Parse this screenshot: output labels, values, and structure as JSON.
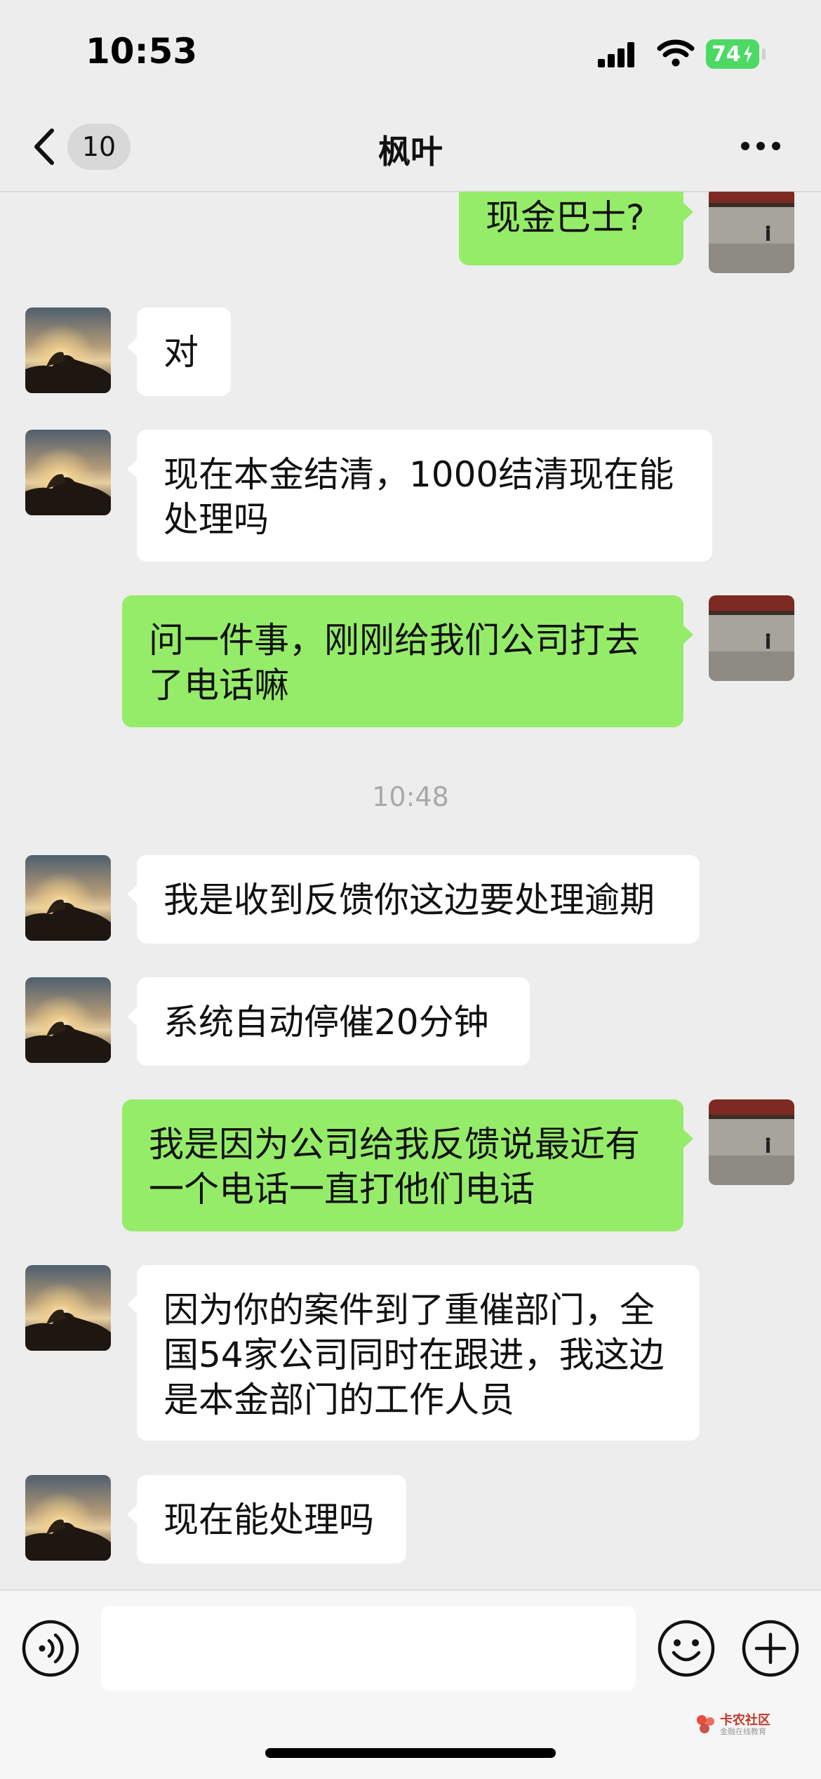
{
  "status_bar": {
    "time": "10:53",
    "battery": "74"
  },
  "header": {
    "unread_count": "10",
    "title": "枫叶"
  },
  "messages": [
    {
      "text": "现金巴士?",
      "dir": "out"
    },
    {
      "text": "对",
      "dir": "in"
    },
    {
      "text": "现在本金结清，1000结清现在能处理吗",
      "dir": "in"
    },
    {
      "text": "问一件事，刚刚给我们公司打去了电话嘛",
      "dir": "out"
    },
    {
      "text": "我是收到反馈你这边要处理逾期",
      "dir": "in"
    },
    {
      "text": "系统自动停催20分钟",
      "dir": "in"
    },
    {
      "text": "我是因为公司给我反馈说最近有一个电话一直打他们电话",
      "dir": "out"
    },
    {
      "text": "因为你的案件到了重催部门，全国54家公司同时在跟进，我这边是本金部门的工作人员",
      "dir": "in"
    },
    {
      "text": "现在能处理吗",
      "dir": "in"
    }
  ],
  "timestamp": "10:48",
  "input": {
    "placeholder": ""
  },
  "watermark": {
    "main": "卡农社区",
    "sub": "金融在线教育"
  },
  "colors": {
    "outgoing_bubble": "#95ec69",
    "incoming_bubble": "#ffffff",
    "background": "#ededed"
  },
  "icons": [
    "back-icon",
    "more-icon",
    "voice-icon",
    "emoji-icon",
    "plus-icon",
    "signal-icon",
    "wifi-icon"
  ]
}
